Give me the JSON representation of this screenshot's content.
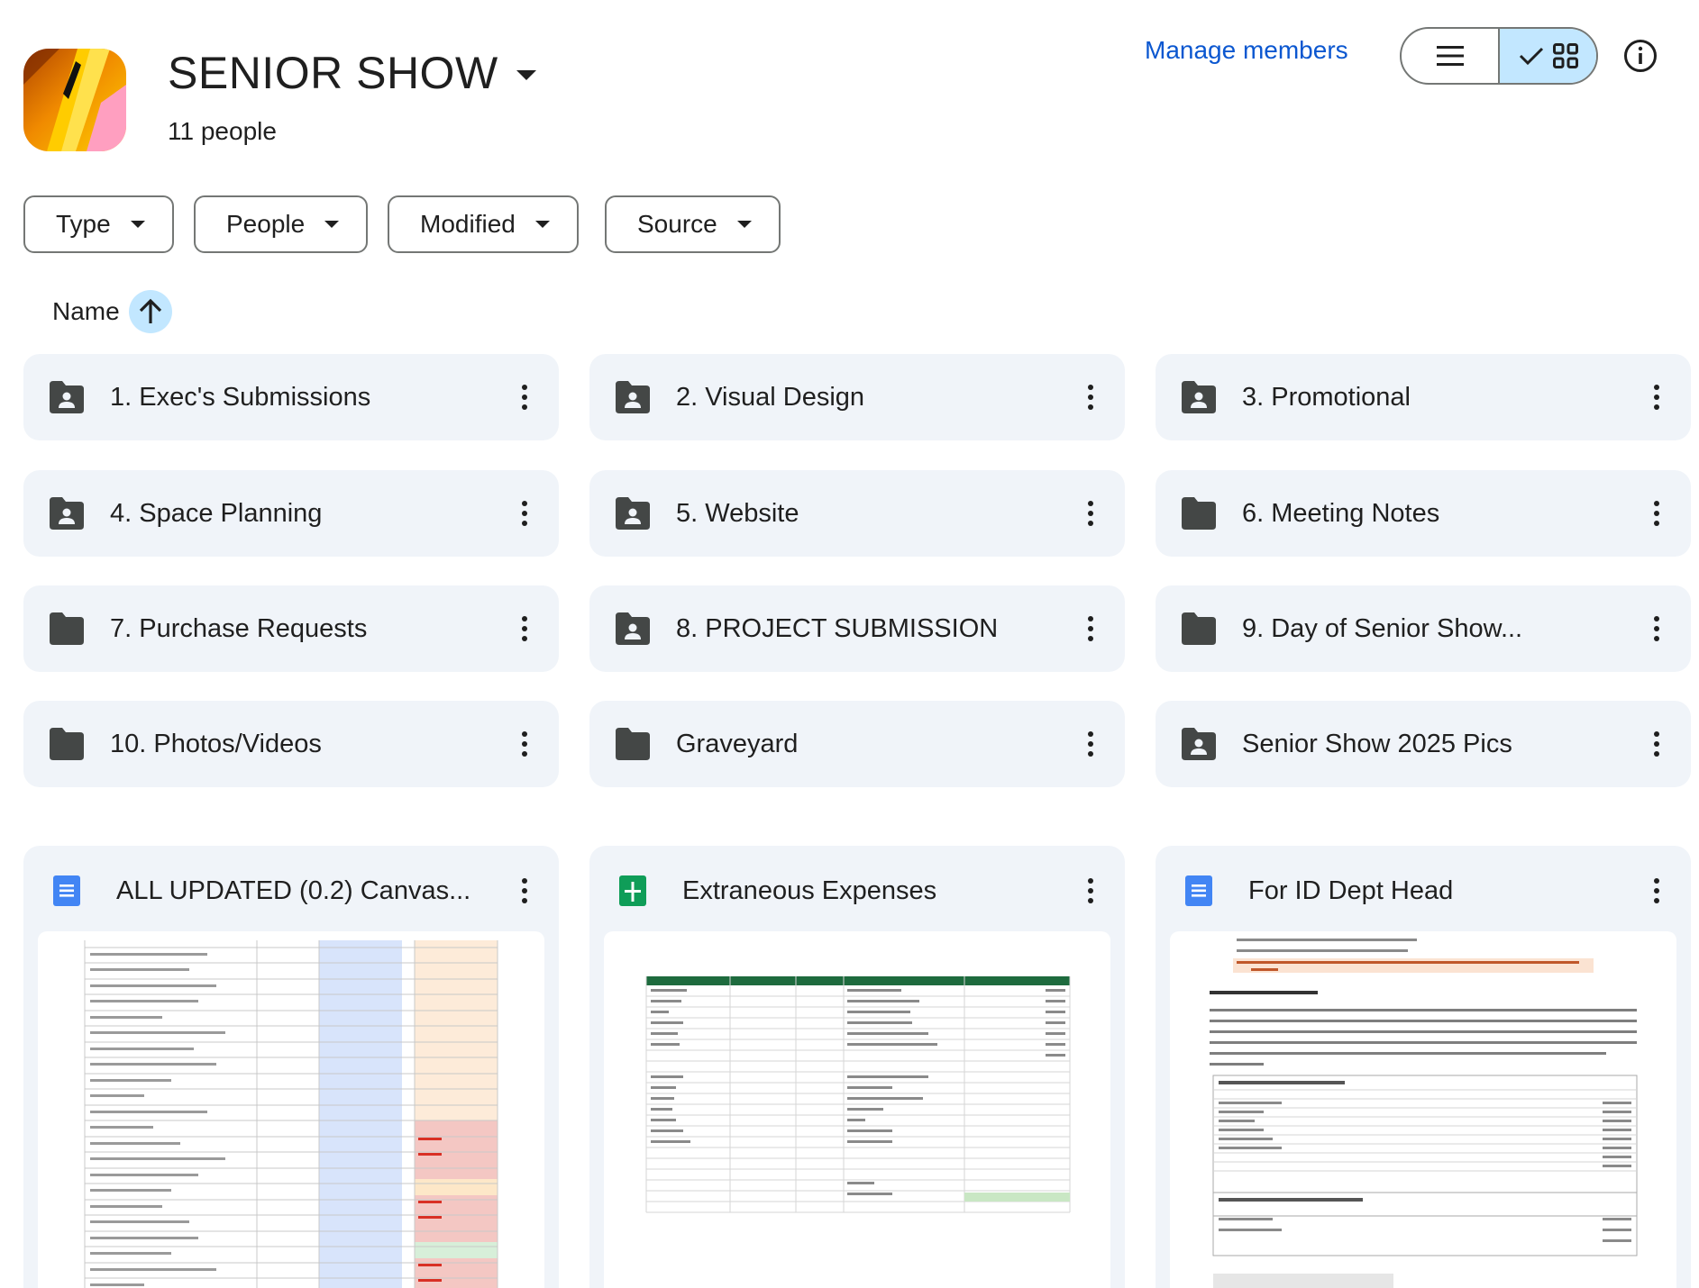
{
  "header": {
    "title": "SENIOR SHOW",
    "people_count": "11 people",
    "manage_members": "Manage members"
  },
  "filters": [
    "Type",
    "People",
    "Modified",
    "Source"
  ],
  "sort": {
    "label": "Name",
    "direction": "ascending"
  },
  "folders": [
    {
      "name": "1. Exec's Submissions",
      "shared": true
    },
    {
      "name": "2. Visual Design",
      "shared": true
    },
    {
      "name": "3. Promotional",
      "shared": true
    },
    {
      "name": "4. Space Planning",
      "shared": true
    },
    {
      "name": "5. Website",
      "shared": true
    },
    {
      "name": "6. Meeting Notes",
      "shared": false
    },
    {
      "name": "7. Purchase Requests",
      "shared": false
    },
    {
      "name": "8. PROJECT SUBMISSION",
      "shared": true
    },
    {
      "name": "9. Day of Senior Show...",
      "shared": false
    },
    {
      "name": "10. Photos/Videos",
      "shared": false
    },
    {
      "name": "Graveyard",
      "shared": false
    },
    {
      "name": "Senior Show 2025 Pics",
      "shared": true
    }
  ],
  "files": [
    {
      "name": "ALL UPDATED (0.2) Canvas...",
      "type": "doc",
      "icon": "google-docs-icon"
    },
    {
      "name": "Extraneous Expenses",
      "type": "sheet",
      "icon": "google-sheets-icon"
    },
    {
      "name": "For ID Dept Head",
      "type": "doc",
      "icon": "google-docs-icon"
    }
  ],
  "colors": {
    "accent": "#0b57d0",
    "selected": "#c2e7ff",
    "card": "#f0f4f9",
    "docs": "#4285f4",
    "sheets": "#0f9d58"
  }
}
